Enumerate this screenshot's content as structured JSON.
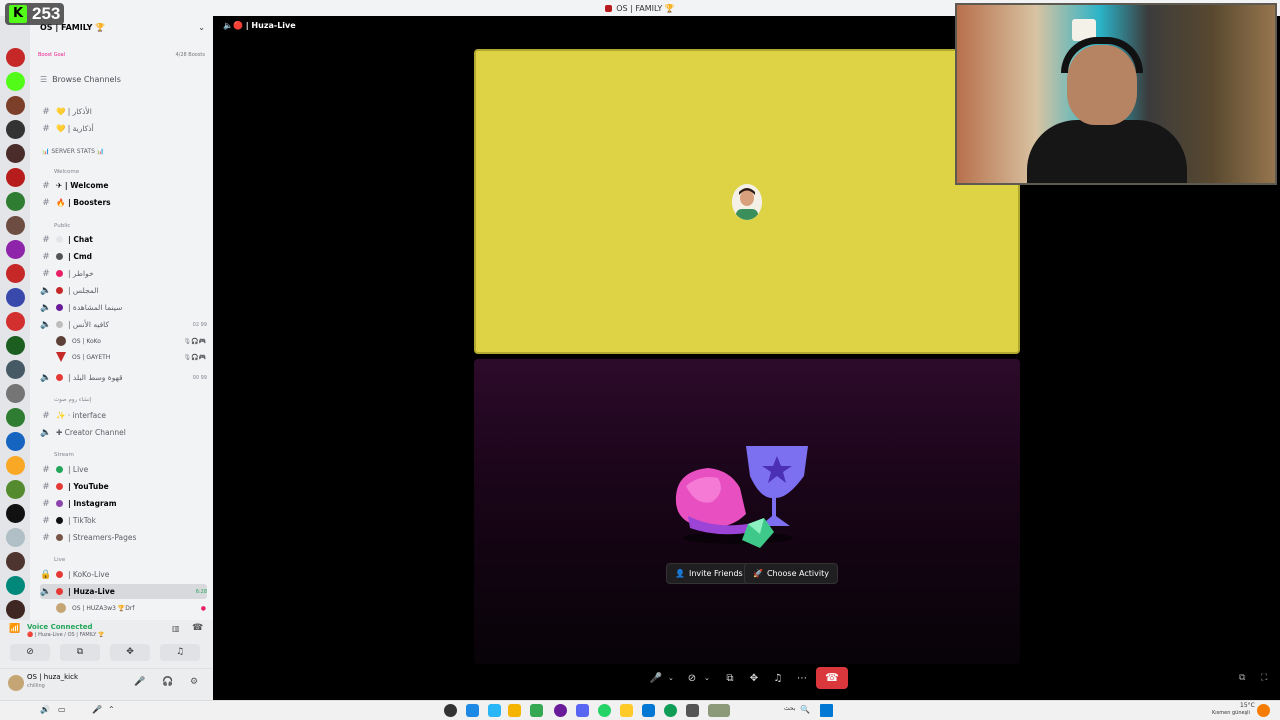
{
  "window": {
    "title": "OS | FAMILY 🏆"
  },
  "overlay": {
    "counter": "253",
    "counter_logo": "K"
  },
  "server": {
    "name": "OS | FAMILY 🏆",
    "boost_goal": "Boost Goal",
    "boosts": "4/28 Boosts",
    "browse": "Browse Channels"
  },
  "channels": [
    {
      "type": "text",
      "label": "💛 | الأذكار",
      "bold": false
    },
    {
      "type": "text",
      "label": "💛 | أذكارية",
      "bold": false
    }
  ],
  "server_stats": "📊 SERVER STATS 📊",
  "categories": {
    "welcome": "Welcome",
    "public": "Public",
    "creators": "إنشاء روم صوت",
    "stream": "Stream",
    "live": "Live"
  },
  "welcome_channels": [
    {
      "label": "✈ | Welcome",
      "emoji_color": "#9e9e9e"
    },
    {
      "label": "🔥 | Boosters",
      "emoji_color": "#f4a261"
    }
  ],
  "public_channels": [
    {
      "type": "text",
      "label": "| Chat",
      "bold": true
    },
    {
      "type": "text",
      "label": "| Cmd",
      "bold": true
    },
    {
      "type": "text",
      "label": "| خواطر",
      "bold": false
    },
    {
      "type": "voice",
      "label": "| المجلس",
      "bold": false
    },
    {
      "type": "voice",
      "label": "| سينما المشاهدة",
      "bold": false
    },
    {
      "type": "voice",
      "label": "| كافيه الأنس",
      "bold": false,
      "count": "02  99"
    }
  ],
  "voice_members": [
    {
      "name": "OS | KoKo",
      "tools": "🎙🎧🎮"
    },
    {
      "name": "OS | GAYETH",
      "tools": "🎙🎧🎮"
    }
  ],
  "voice_after": {
    "label": "| قهوة وسط البلد",
    "count": "00  99"
  },
  "creator_channels": [
    {
      "type": "text",
      "label": "✨ · interface"
    },
    {
      "type": "voice",
      "label": "✚ Creator Channel"
    }
  ],
  "stream_channels": [
    {
      "label": "| Live",
      "color": "#23a55a"
    },
    {
      "label": "| YouTube",
      "color": "#e53935"
    },
    {
      "label": "| Instagram",
      "color": "#8e44ad"
    },
    {
      "label": "| TikTok",
      "color": "#111111"
    },
    {
      "label": "| Streamers-Pages",
      "color": "#795548"
    }
  ],
  "live_channels": [
    {
      "label": "| KoKo-Live",
      "selected": false
    },
    {
      "label": "| Huza-Live",
      "selected": true,
      "timer": "6:28"
    }
  ],
  "live_member": {
    "name": "OS | HUZA3w3 🏆Drf"
  },
  "voice_panel": {
    "status": "Voice Connected",
    "location": "🔴 | Huza-Live / OS | FAMILY 🏆"
  },
  "user_panel": {
    "name": "OS | huza_kick",
    "status": "chilling"
  },
  "call": {
    "channel": "🔴 | Huza-Live",
    "invite": "Invite Friends",
    "activity": "Choose Activity"
  },
  "taskbar": {
    "weather": "15°C",
    "weather_sub": "Kısmen güneşli",
    "search": "بحث"
  },
  "colors": {
    "tile_yellow": "#ddd344",
    "hangup": "#da373c",
    "voice_green": "#23a55a",
    "kick_green": "#53fc18"
  }
}
